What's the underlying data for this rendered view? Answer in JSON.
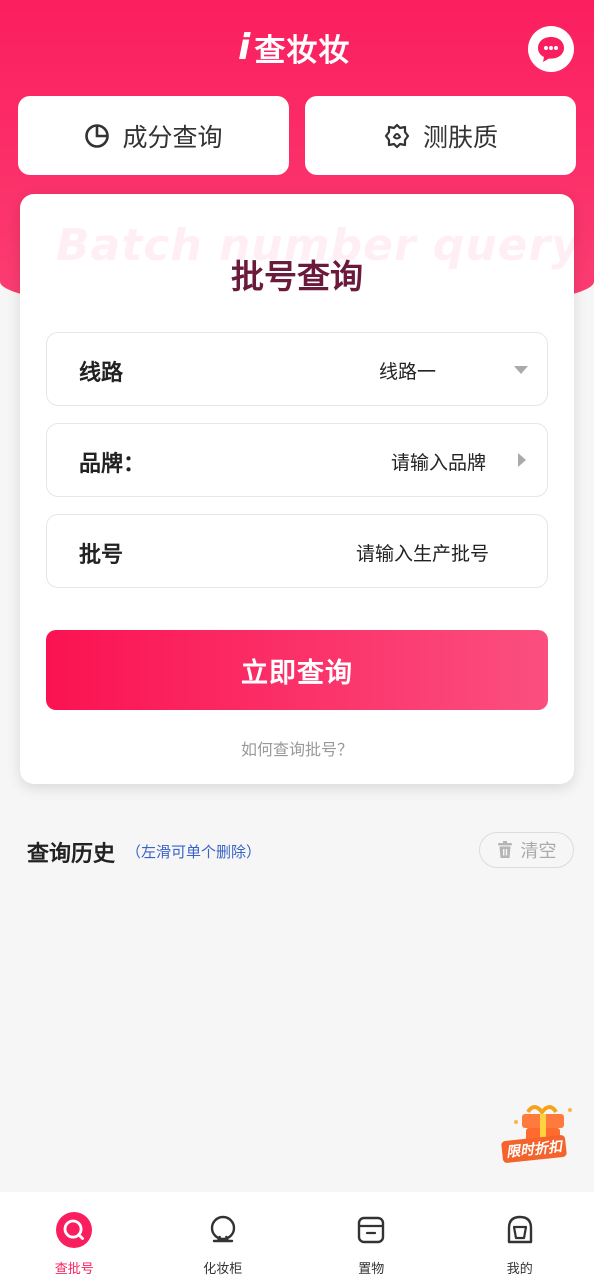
{
  "header": {
    "logo_i": "i",
    "logo_text": "查妆妆"
  },
  "quick_actions": [
    {
      "label": "成分查询",
      "icon": "pie-chart-icon"
    },
    {
      "label": "测肤质",
      "icon": "skin-test-icon"
    }
  ],
  "query_card": {
    "watermark": "Batch number query",
    "title": "批号查询",
    "fields": [
      {
        "label": "线路",
        "value": "线路一"
      },
      {
        "label": "品牌：",
        "value": "请输入品牌"
      },
      {
        "label": "批号",
        "placeholder": "请输入生产批号"
      }
    ],
    "submit_label": "立即查询",
    "help_link": "如何查询批号？"
  },
  "history": {
    "title": "查询历史",
    "hint": "（左滑可单个删除）",
    "clear_label": "清空"
  },
  "promo": {
    "label": "限时折扣"
  },
  "tabbar": {
    "active": 0,
    "items": [
      {
        "label": "查批号",
        "icon": "search-icon"
      },
      {
        "label": "化妆柜",
        "icon": "cabinet-icon"
      },
      {
        "label": "置物",
        "icon": "box-icon"
      },
      {
        "label": "我的",
        "icon": "profile-icon"
      }
    ]
  },
  "colors": {
    "brand": "#fb1e5e",
    "title": "#6a1a3a",
    "hint": "#3a63c8"
  }
}
